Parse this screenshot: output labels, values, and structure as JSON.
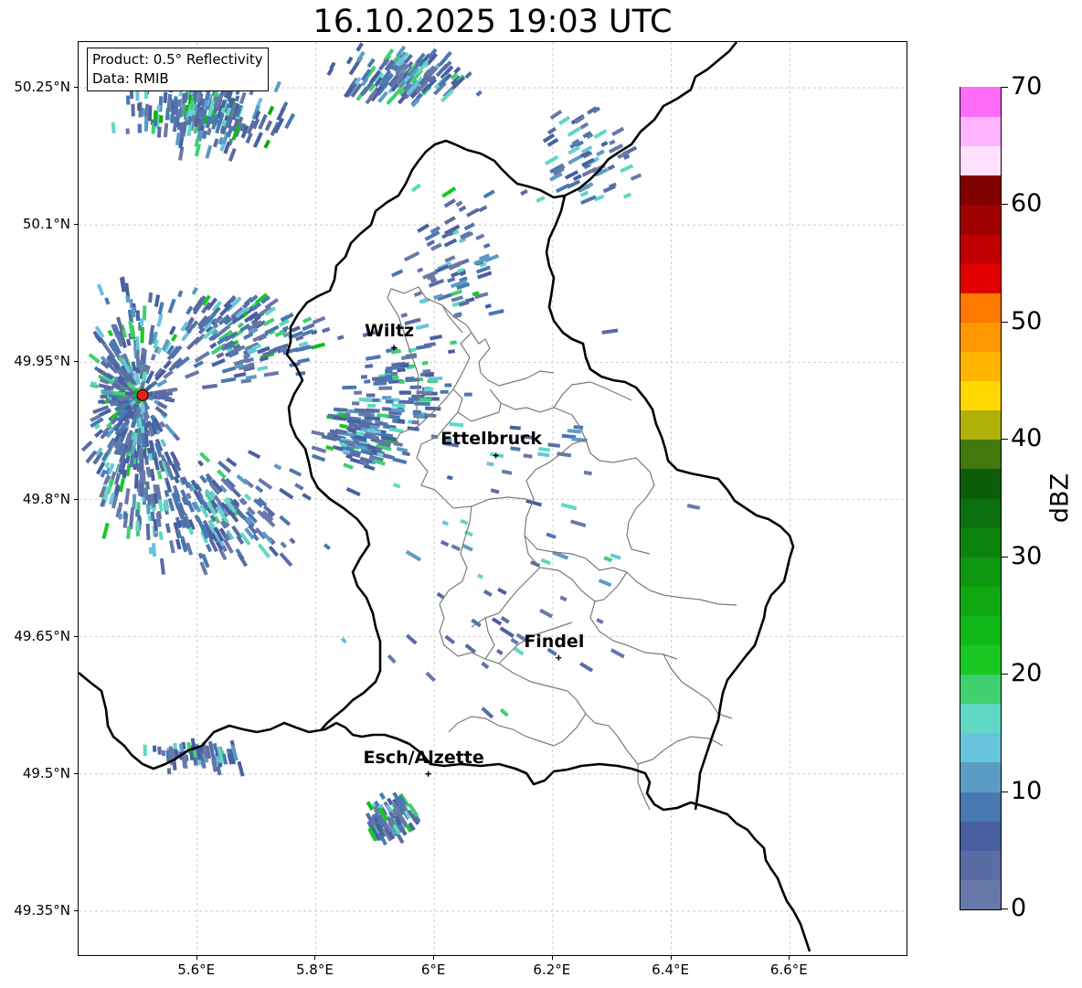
{
  "title": "16.10.2025 19:03 UTC",
  "info_box": {
    "product": "Product: 0.5° Reflectivity",
    "data": "Data: RMIB"
  },
  "lat_labels": [
    "50.25°N",
    "50.1°N",
    "49.95°N",
    "49.8°N",
    "49.65°N",
    "49.5°N",
    "49.35°N"
  ],
  "lon_labels": [
    "5.6°E",
    "5.8°E",
    "6°E",
    "6.2°E",
    "6.4°E",
    "6.6°E"
  ],
  "map_extent": {
    "lon": [
      5.4,
      6.8
    ],
    "lat": [
      49.3,
      50.3
    ]
  },
  "radar_site": {
    "lon": 5.505,
    "lat": 49.914,
    "color": "#e8201c"
  },
  "cities": [
    {
      "name": "Wiltz",
      "lon": 5.932,
      "lat": 49.966
    },
    {
      "name": "Ettelbruck",
      "lon": 6.104,
      "lat": 49.848
    },
    {
      "name": "Findel",
      "lon": 6.21,
      "lat": 49.627
    },
    {
      "name": "Esch/Alzette",
      "lon": 5.99,
      "lat": 49.5
    }
  ],
  "colorbar": {
    "label": "dBZ",
    "ticks": [
      "0",
      "10",
      "20",
      "30",
      "40",
      "50",
      "60",
      "70"
    ],
    "min": 0,
    "max": 70,
    "step": 2.5,
    "colors": [
      "#6878a8",
      "#5a6ca4",
      "#4860a0",
      "#4a78b0",
      "#5a9cc4",
      "#68c4dc",
      "#60d8c4",
      "#40d070",
      "#18c820",
      "#10b818",
      "#10a810",
      "#0e9810",
      "#0c840c",
      "#0a7010",
      "#0a5e0a",
      "#42780e",
      "#b0b008",
      "#ffd800",
      "#ffb400",
      "#ff9800",
      "#ff7800",
      "#e00000",
      "#c00000",
      "#a00000",
      "#800000",
      "#ffe0ff",
      "#ffb4ff",
      "#ff6cf8",
      "#e838e8"
    ]
  },
  "chart_data": {
    "type": "heatmap",
    "title": "16.10.2025 19:03 UTC",
    "variable": "0.5° Reflectivity",
    "units": "dBZ",
    "source": "RMIB",
    "value_range": [
      0,
      70
    ],
    "xlabel": "",
    "ylabel": "",
    "x_ticks": [
      "5.6°E",
      "5.8°E",
      "6°E",
      "6.2°E",
      "6.4°E",
      "6.6°E"
    ],
    "y_ticks": [
      "50.25°N",
      "50.1°N",
      "49.95°N",
      "49.8°N",
      "49.65°N",
      "49.5°N",
      "49.35°N"
    ],
    "grid": true,
    "echo_clusters": [
      {
        "lon": 5.62,
        "lat": 50.22,
        "spread_lon": 0.17,
        "spread_lat": 0.05,
        "n": 220,
        "max_dbz": 28
      },
      {
        "lon": 5.95,
        "lat": 50.26,
        "spread_lon": 0.15,
        "spread_lat": 0.04,
        "n": 140,
        "max_dbz": 18
      },
      {
        "lon": 5.49,
        "lat": 49.9,
        "spread_lon": 0.09,
        "spread_lat": 0.16,
        "n": 420,
        "max_dbz": 22
      },
      {
        "lon": 5.62,
        "lat": 49.78,
        "spread_lon": 0.2,
        "spread_lat": 0.08,
        "n": 200,
        "max_dbz": 16
      },
      {
        "lon": 5.68,
        "lat": 49.98,
        "spread_lon": 0.2,
        "spread_lat": 0.07,
        "n": 170,
        "max_dbz": 24
      },
      {
        "lon": 5.88,
        "lat": 49.87,
        "spread_lon": 0.1,
        "spread_lat": 0.05,
        "n": 140,
        "max_dbz": 22
      },
      {
        "lon": 5.95,
        "lat": 49.93,
        "spread_lon": 0.12,
        "spread_lat": 0.08,
        "n": 90,
        "max_dbz": 20
      },
      {
        "lon": 6.03,
        "lat": 50.05,
        "spread_lon": 0.1,
        "spread_lat": 0.12,
        "n": 70,
        "max_dbz": 22
      },
      {
        "lon": 6.25,
        "lat": 50.17,
        "spread_lon": 0.12,
        "spread_lat": 0.08,
        "n": 60,
        "max_dbz": 14
      },
      {
        "lon": 5.93,
        "lat": 49.45,
        "spread_lon": 0.06,
        "spread_lat": 0.03,
        "n": 90,
        "max_dbz": 24
      },
      {
        "lon": 5.6,
        "lat": 49.52,
        "spread_lon": 0.14,
        "spread_lat": 0.02,
        "n": 70,
        "max_dbz": 20
      },
      {
        "lon": 6.1,
        "lat": 49.75,
        "spread_lon": 0.35,
        "spread_lat": 0.3,
        "n": 70,
        "max_dbz": 12
      }
    ]
  }
}
